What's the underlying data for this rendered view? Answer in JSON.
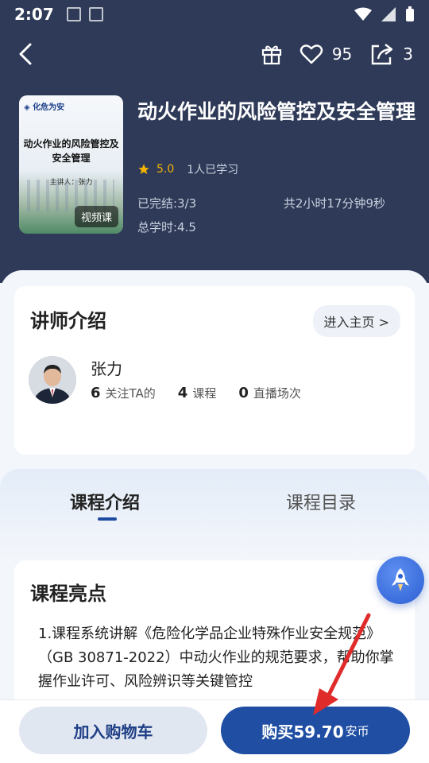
{
  "status_bar": {
    "time": "2:07"
  },
  "header": {
    "favorites_count": "95",
    "shares_count": "3"
  },
  "course": {
    "title": "动火作业的风险管控及安全管理",
    "rating": "5.0",
    "learners": "1人已学习",
    "completed": "已完结:3/3",
    "duration": "共2小时17分钟9秒",
    "total_hours": "总学时:4.5",
    "cover": {
      "title_line1": "动火作业的风险管控及",
      "title_line2": "安全管理",
      "lecturer": "主讲人：张力",
      "tag": "视频课"
    }
  },
  "teacher": {
    "section_title": "讲师介绍",
    "home_button": "进入主页 >",
    "name": "张力",
    "followers_value": "6",
    "followers_label": "关注TA的",
    "courses_value": "4",
    "courses_label": "课程",
    "live_value": "0",
    "live_label": "直播场次"
  },
  "tabs": {
    "intro": "课程介绍",
    "catalog": "课程目录"
  },
  "highlights": {
    "title": "课程亮点",
    "text": "1.课程系统讲解《危险化学品企业特殊作业安全规范》（GB 30871-2022）中动火作业的规范要求，帮助你掌握作业许可、风险辨识等关键管控"
  },
  "bottom": {
    "cart_label": "加入购物车",
    "buy_label": "购买59.70",
    "buy_unit": "安币"
  },
  "colors": {
    "header_bg": "#2e3a58",
    "accent": "#1f4ea3",
    "star": "#f4b400",
    "annotation_arrow": "#e02b2b"
  },
  "icons": [
    "back-icon",
    "gift-icon",
    "heart-icon",
    "share-icon",
    "star-icon",
    "rocket-icon"
  ]
}
